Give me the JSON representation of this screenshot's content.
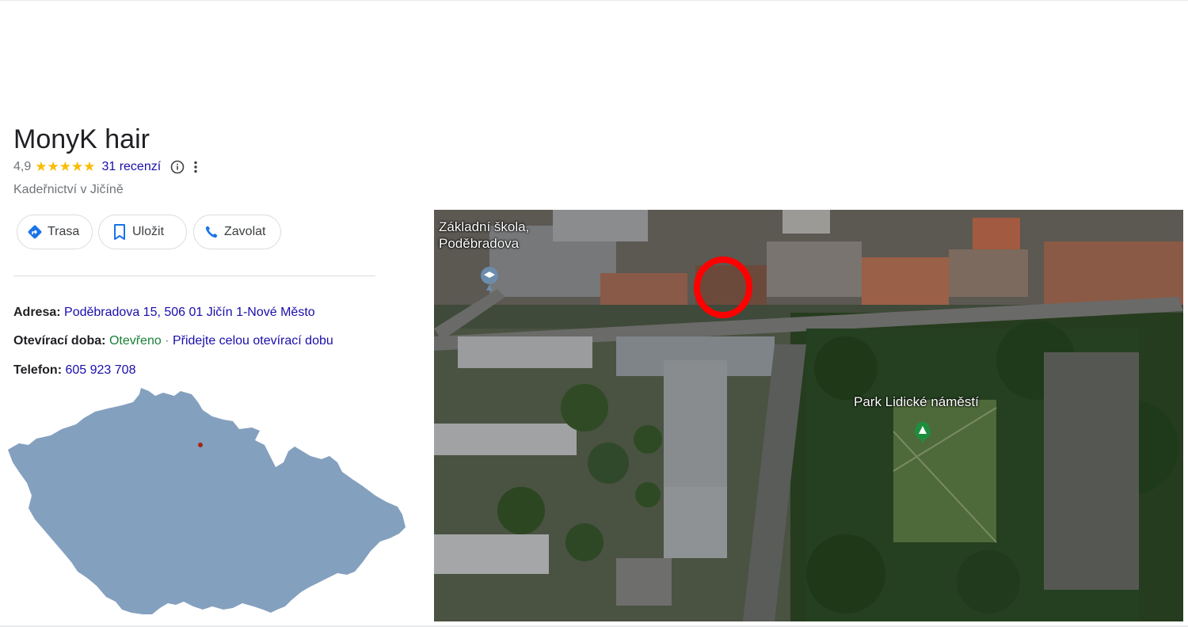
{
  "business": {
    "name": "MonyK hair",
    "rating": "4,9",
    "stars": "★★★★★",
    "reviews_link": "31 recenzí",
    "category": "Kadeřnictví v Jičíně"
  },
  "actions": {
    "directions_label": "Trasa",
    "save_label": "Uložit",
    "call_label": "Zavolat"
  },
  "details": {
    "address_label": "Adresa:",
    "address_value": "Poděbradova 15, 506 01 Jičín 1-Nové Město",
    "hours_label": "Otevírací doba:",
    "hours_status": "Otevřeno",
    "hours_separator": " · ",
    "hours_link": "Přidejte celou otevírací dobu",
    "phone_label": "Telefon:",
    "phone_value": "605 923 708"
  },
  "map": {
    "label_school": "Základní škola,\nPoděbradova",
    "label_park": "Park Lidické náměstí"
  },
  "colors": {
    "link": "#1a0dab",
    "open_green": "#188038",
    "star_yellow": "#fbbc04",
    "country_fill": "#84a0bf",
    "marker_ring": "#ff0000"
  },
  "icons": [
    "info-icon",
    "more-vert-icon",
    "directions-icon",
    "bookmark-icon",
    "phone-icon",
    "school-pin-icon",
    "park-pin-icon"
  ]
}
